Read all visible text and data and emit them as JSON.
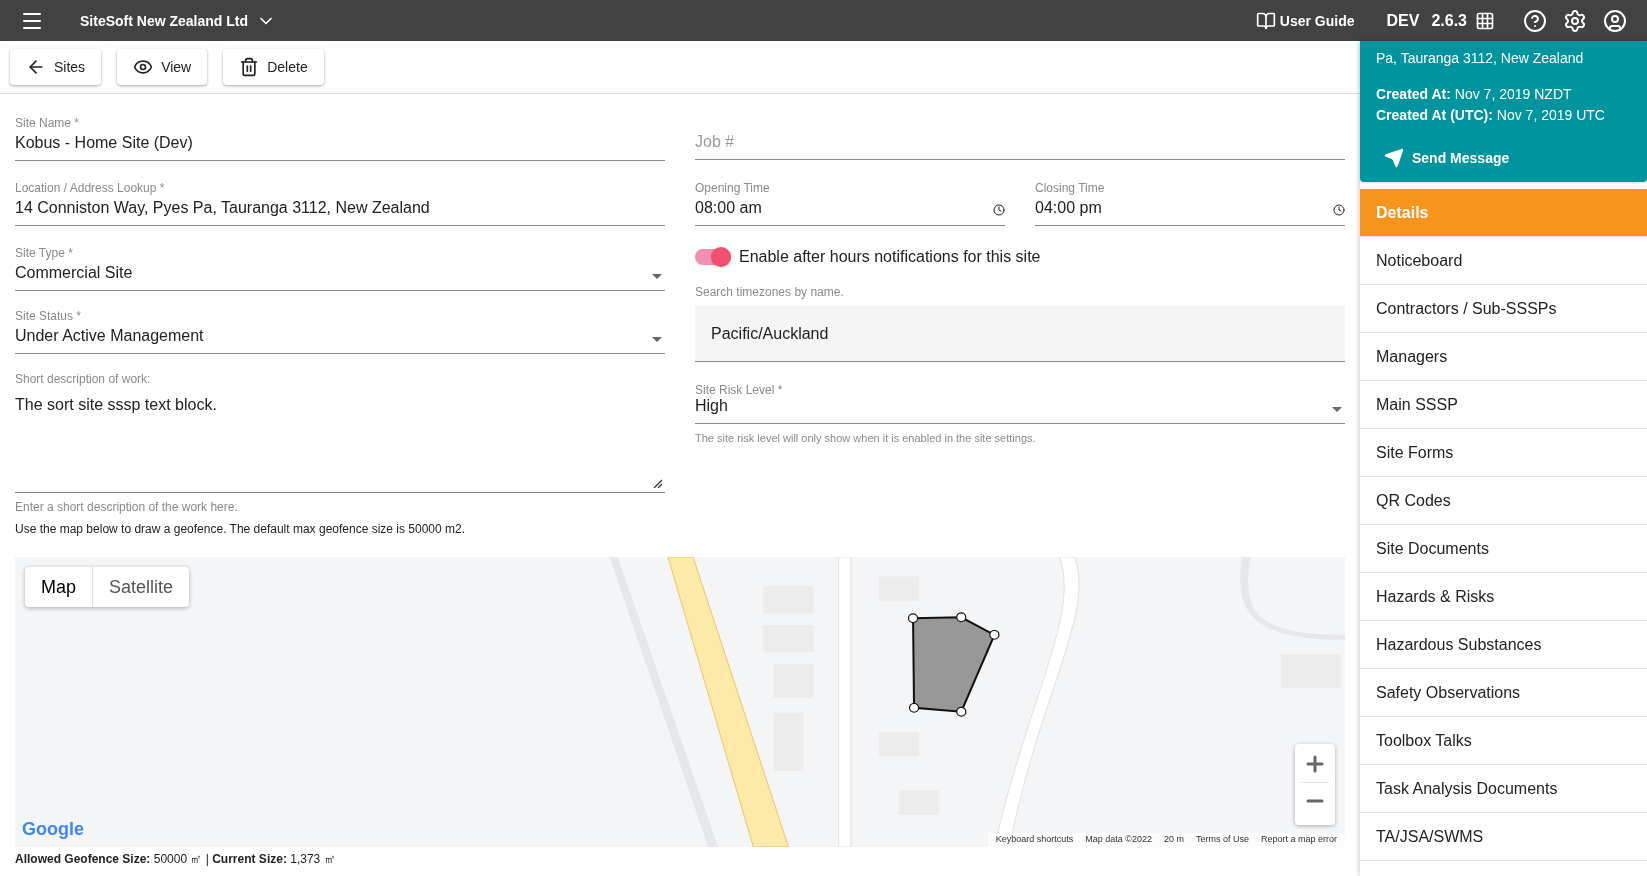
{
  "topbar": {
    "company": "SiteSoft New Zealand Ltd",
    "user_guide": "User Guide",
    "environment": "DEV",
    "version": "2.6.3"
  },
  "toolbar": [
    {
      "kind": "back",
      "label": "Sites"
    },
    {
      "kind": "view",
      "label": "View"
    },
    {
      "kind": "delete",
      "label": "Delete"
    }
  ],
  "left_fields": [
    {
      "kind": "text",
      "label": "Site Name *",
      "value": "Kobus - Home Site (Dev)"
    },
    {
      "kind": "text",
      "label": "Location / Address Lookup *",
      "value": "14 Conniston Way, Pyes Pa, Tauranga 3112, New Zealand"
    },
    {
      "kind": "select",
      "label": "Site Type *",
      "value": "Commercial Site"
    },
    {
      "kind": "select",
      "label": "Site Status *",
      "value": "Under Active Management"
    },
    {
      "kind": "textarea",
      "label": "Short description of work:",
      "value": "The sort site sssp text block.",
      "helper": "Enter a short description of the work here."
    }
  ],
  "geofence_note": "Use the map below to draw a geofence. The default max geofence size is 50000 m2.",
  "job_field": {
    "placeholder": "Job #"
  },
  "time_fields": [
    {
      "label": "Opening Time",
      "value": "08:00 am"
    },
    {
      "label": "Closing Time",
      "value": "04:00 pm"
    }
  ],
  "after_hours_toggle": {
    "label": "Enable after hours notifications for this site",
    "on": true
  },
  "timezone": {
    "label": "Search timezones by name.",
    "value": "Pacific/Auckland"
  },
  "risk_level": {
    "label": "Site Risk Level *",
    "value": "High",
    "helper": "The site risk level will only show when it is enabled in the site settings."
  },
  "map": {
    "type_buttons": [
      {
        "label": "Map",
        "selected": true
      },
      {
        "label": "Satellite",
        "selected": false
      }
    ],
    "logo": "Google",
    "attribution": [
      "Keyboard shortcuts",
      "Map data ©2022",
      "20 m",
      "Terms of Use",
      "Report a map error"
    ]
  },
  "geofence_size": "**Allowed Geofence Size:** 50000 ㎡ | **Current Size:** 1,373 ㎡",
  "site_card": {
    "lines": [
      "Pa, Tauranga 3112, New Zealand"
    ],
    "created": [
      "**Created At:** Nov 7, 2019 NZDT",
      "**Created At (UTC):** Nov 7, 2019 UTC"
    ],
    "send_button": "Send Message"
  },
  "nav_items": [
    {
      "label": "Details",
      "selected": true
    },
    {
      "label": "Noticeboard",
      "selected": false
    },
    {
      "label": "Contractors / Sub-SSSPs",
      "selected": false
    },
    {
      "label": "Managers",
      "selected": false
    },
    {
      "label": "Main SSSP",
      "selected": false
    },
    {
      "label": "Site Forms",
      "selected": false
    },
    {
      "label": "QR Codes",
      "selected": false
    },
    {
      "label": "Site Documents",
      "selected": false
    },
    {
      "label": "Hazards & Risks",
      "selected": false
    },
    {
      "label": "Hazardous Substances",
      "selected": false
    },
    {
      "label": "Safety Observations",
      "selected": false
    },
    {
      "label": "Toolbox Talks",
      "selected": false
    },
    {
      "label": "Task Analysis Documents",
      "selected": false
    },
    {
      "label": "TA/JSA/SWMS",
      "selected": false
    }
  ]
}
